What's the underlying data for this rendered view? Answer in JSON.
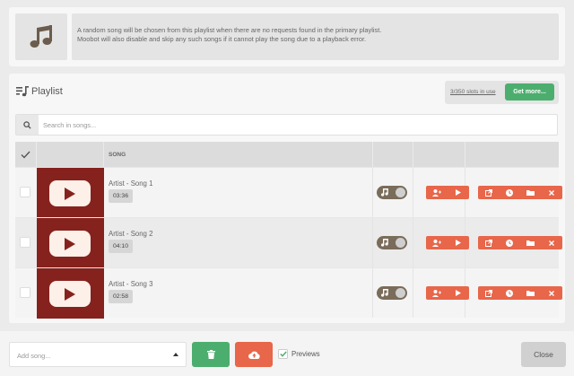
{
  "info": {
    "icon": "music-note-icon",
    "line1": "A random song will be chosen from this playlist when there are no requests found in the primary playlist.",
    "line2": "Moobot will also disable and skip any such songs if it cannot play the song due to a playback error."
  },
  "playlist": {
    "title": "Playlist",
    "title_icon": "playlist-icon",
    "slots_text": "3/350 slots in use",
    "get_more_label": "Get more...",
    "search_placeholder": "Search in songs...",
    "columns": {
      "song": "SONG"
    },
    "rows": [
      {
        "title": "Artist - Song 1",
        "duration": "03:36"
      },
      {
        "title": "Artist - Song 2",
        "duration": "04:10"
      },
      {
        "title": "Artist - Song 3",
        "duration": "02:58"
      }
    ]
  },
  "footer": {
    "add_song_placeholder": "Add song...",
    "previews_label": "Previews",
    "previews_checked": true,
    "close_label": "Close"
  },
  "colors": {
    "green": "#4cae6e",
    "orange": "#e8664a",
    "thumbnail": "#86221d",
    "toggle": "#7a6c5a"
  }
}
